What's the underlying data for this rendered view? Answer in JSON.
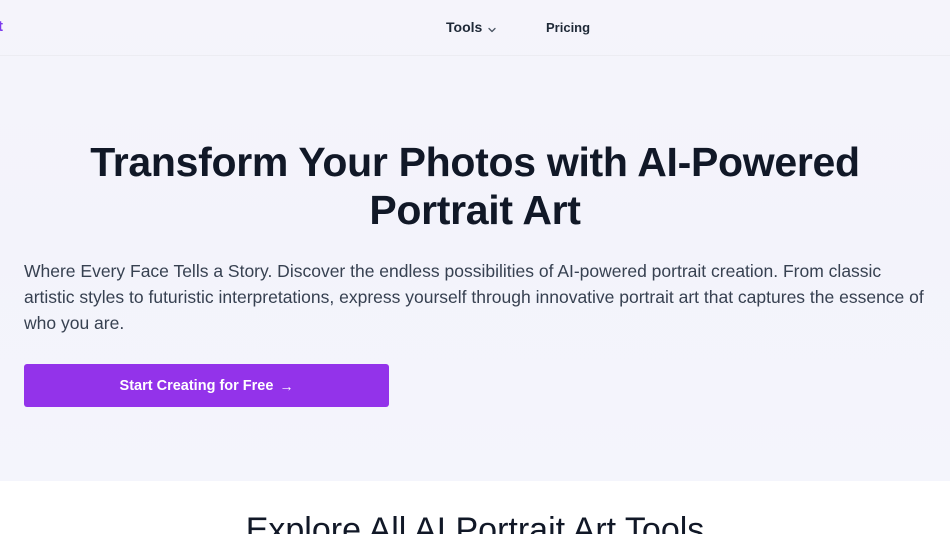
{
  "nav": {
    "logo_fragment": "t",
    "tools_label": "Tools",
    "pricing_label": "Pricing"
  },
  "hero": {
    "title_line1": "Transform Your Photos with AI-Powered",
    "title_line2": "Portrait Art",
    "description": "Where Every Face Tells a Story. Discover the endless possibilities of AI-powered portrait creation. From classic artistic styles to futuristic interpretations, express yourself through innovative portrait art that captures the essence of who you are.",
    "cta_label": "Start Creating for Free",
    "cta_arrow": "→"
  },
  "section2": {
    "title": "Explore All AI Portrait Art Tools"
  },
  "colors": {
    "accent": "#9333ea",
    "logo": "#7c3aed",
    "text_dark": "#111827"
  },
  "icons": {
    "tools_dropdown": "chevron-down-icon",
    "cta": "arrow-right-icon"
  }
}
